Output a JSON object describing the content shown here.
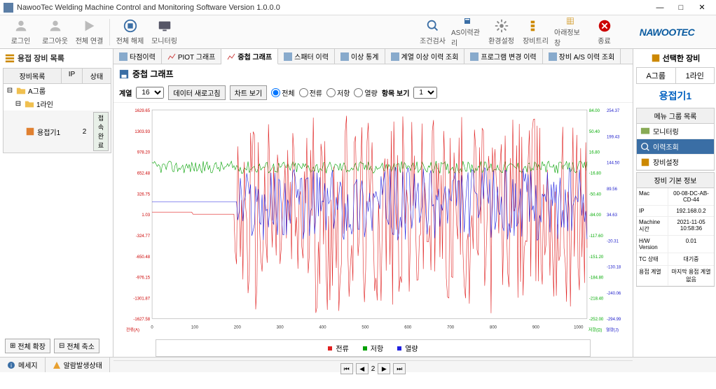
{
  "window": {
    "title": "NawooTec Welding Machine Control and Monitoring Software Version 1.0.0.0"
  },
  "toolbar": {
    "login": "로그인",
    "logout": "로그아웃",
    "connectAll": "전체 연결",
    "disconnectAll": "전체 해제",
    "monitoring": "모니터링",
    "condCheck": "조건검사",
    "asHistory": "AS이력관리",
    "envSetting": "환경설정",
    "equipTree": "장비트리",
    "subInfo": "아래정보창",
    "exit": "종료"
  },
  "logo": "NAWOOTEC",
  "leftPanel": {
    "title": "용접 장비 목록",
    "headers": {
      "name": "장비목록",
      "ip": "IP",
      "status": "상태"
    },
    "groupA": "A그룹",
    "line1": "1라인",
    "device": {
      "name": "용접기1",
      "ip": "2",
      "status": "접속완료"
    },
    "expandAll": "전체 확장",
    "collapseAll": "전체 축소"
  },
  "tabs": {
    "t1": "타점이력",
    "t2": "PIOT 그래프",
    "t3": "중첩 그래프",
    "t4": "스패터 이력",
    "t5": "이상 통계",
    "t6": "계열 이상 이력 조회",
    "t7": "프로그램 변경 이력",
    "t8": "장비 A/S 이력 조회"
  },
  "chart": {
    "title": "중첩 그래프",
    "seriesLabel": "계열",
    "seriesVal": "16",
    "refresh": "데이터 새로고침",
    "viewChart": "차트 보기",
    "optAll": "전체",
    "optCurrent": "전류",
    "optResist": "저항",
    "optHeat": "열량",
    "itemView": "항목 보기",
    "itemVal": "1",
    "legend": {
      "current": "전류",
      "resist": "저항",
      "heat": "열량"
    },
    "pager": {
      "first": "⏮",
      "prev": "◀",
      "page": "2",
      "next": "▶",
      "last": "⏭"
    }
  },
  "chart_data": {
    "type": "line",
    "x_range": [
      0,
      1020
    ],
    "x_ticks": [
      0,
      100,
      200,
      300,
      400,
      500,
      600,
      700,
      800,
      900,
      1000
    ],
    "series": [
      {
        "name": "전류",
        "color": "#e02020",
        "axis_label": "전류(A)",
        "y_ticks": [
          -1627.58,
          -1301.87,
          -976.15,
          -650.48,
          -324.77,
          1.03,
          326.75,
          652.48,
          978.2,
          1303.93,
          1629.65
        ]
      },
      {
        "name": "저항",
        "color": "#00a000",
        "axis_label": "저항(Ω)",
        "y_ticks": [
          -252.0,
          -218.4,
          -184.8,
          -151.2,
          -117.6,
          -84.0,
          -50.4,
          -16.8,
          16.8,
          50.4,
          84.0
        ]
      },
      {
        "name": "열량",
        "color": "#2020e0",
        "axis_label": "열량(J)",
        "y_ticks": [
          -294.99,
          -240.06,
          -130.18,
          -20.31,
          34.63,
          89.56,
          144.5,
          199.43,
          254.37
        ]
      }
    ],
    "note": "dense overlapping noisy lines; resist (green) mostly flat near top-third until x≈300 then noisy; current (red) highly oscillating ±1600 after x≈200; heat (blue) flat then oscillating after x≈200"
  },
  "rightPanel": {
    "title": "선택한 장비",
    "group": "A그룹",
    "line": "1라인",
    "device": "용접기1",
    "menuTitle": "메뉴 그룹 목록",
    "menu": {
      "monitor": "모니터링",
      "history": "이력조회",
      "setting": "장비설정"
    },
    "infoTitle": "장비 기본 정보",
    "info": {
      "macK": "Mac",
      "macV": "00-08-DC-AB-CD-44",
      "ipK": "IP",
      "ipV": "192.168.0.2",
      "timeK": "Machine 시간",
      "timeV": "2021-11-05 10:58:36",
      "hwK": "H/W Version",
      "hwV": "0.01",
      "tcK": "TC 상태",
      "tcV": "대기중",
      "weldK": "용접 계열",
      "weldV": "마지막 용접 계열 없음"
    }
  },
  "bottom": {
    "msg": "메세지",
    "alarm": "알람발생상태"
  }
}
